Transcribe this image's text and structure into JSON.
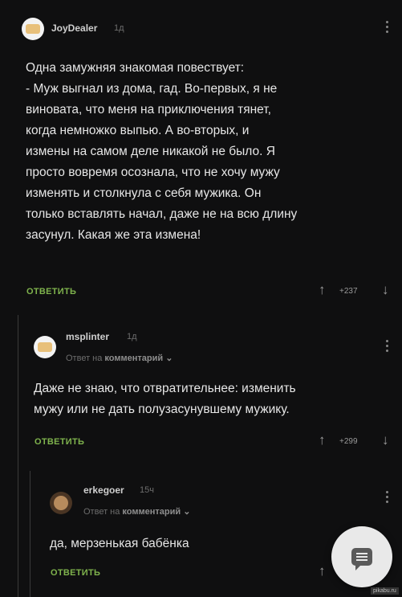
{
  "comments": [
    {
      "username": "JoyDealer",
      "time": "1д",
      "text_lines": [
        "Одна замужняя знакомая повествует:",
        "- Муж выгнал из дома, гад. Во-первых, я не",
        "виновата, что меня на приключения тянет,",
        "когда немножко выпью. А во-вторых, и",
        "измены на самом деле никакой не было. Я",
        "просто вовремя осознала, что не хочу мужу",
        "изменять и столкнула с себя мужика. Он",
        "только вставлять начал, даже не на всю длину",
        "засунул. Какая же эта измена!"
      ],
      "reply_label": "ОТВЕТИТЬ",
      "score": "+237"
    },
    {
      "username": "msplinter",
      "time": "1д",
      "reply_to_prefix": "Ответ на",
      "reply_to_target": "комментарий",
      "text_lines": [
        "Даже не знаю, что отвратительнее: изменить",
        "мужу или не дать полузасунувшему мужику."
      ],
      "reply_label": "ОТВЕТИТЬ",
      "score": "+299"
    },
    {
      "username": "erkegoer",
      "time": "15ч",
      "reply_to_prefix": "Ответ на",
      "reply_to_target": "комментарий",
      "text_lines": [
        "да, мерзенькая бабёнка"
      ],
      "reply_label": "ОТВЕТИТЬ"
    }
  ],
  "icons": {
    "upvote": "↑",
    "downvote": "↓",
    "chevron": "⌄",
    "fab": "comment-icon"
  },
  "watermark": "pikabu.ru",
  "colors": {
    "background": "#0f0f10",
    "reply_green": "#7fb34d",
    "fab": "#e9e9e9"
  }
}
